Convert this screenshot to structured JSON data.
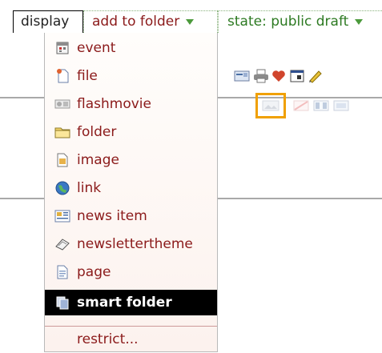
{
  "tabs": {
    "display": "display",
    "add_to_folder": "add to folder",
    "state": "state: public draft"
  },
  "menu": {
    "items": [
      {
        "label": "event",
        "icon": "event-icon"
      },
      {
        "label": "file",
        "icon": "file-icon"
      },
      {
        "label": "flashmovie",
        "icon": "flashmovie-icon"
      },
      {
        "label": "folder",
        "icon": "folder-icon"
      },
      {
        "label": "image",
        "icon": "image-icon"
      },
      {
        "label": "link",
        "icon": "link-icon"
      },
      {
        "label": "news item",
        "icon": "news-item-icon"
      },
      {
        "label": "newslettertheme",
        "icon": "newslettertheme-icon"
      },
      {
        "label": "page",
        "icon": "page-icon"
      },
      {
        "label": "smart folder",
        "icon": "smart-folder-icon"
      }
    ],
    "selected_item": "smart folder",
    "restrict_label": "restrict..."
  },
  "toolbar": {
    "icons": [
      "mail-icon",
      "print-icon",
      "favorite-icon",
      "fullscreen-icon",
      "edit-icon"
    ],
    "secondary_icons": [
      "thumbnail-view-icon",
      "flag-icon",
      "window-icon",
      "mail-faded-icon"
    ]
  },
  "colors": {
    "link": "#8b1a1a",
    "state": "#2d7a22",
    "selected_bg": "#000000",
    "highlight_border": "#f0a000"
  }
}
